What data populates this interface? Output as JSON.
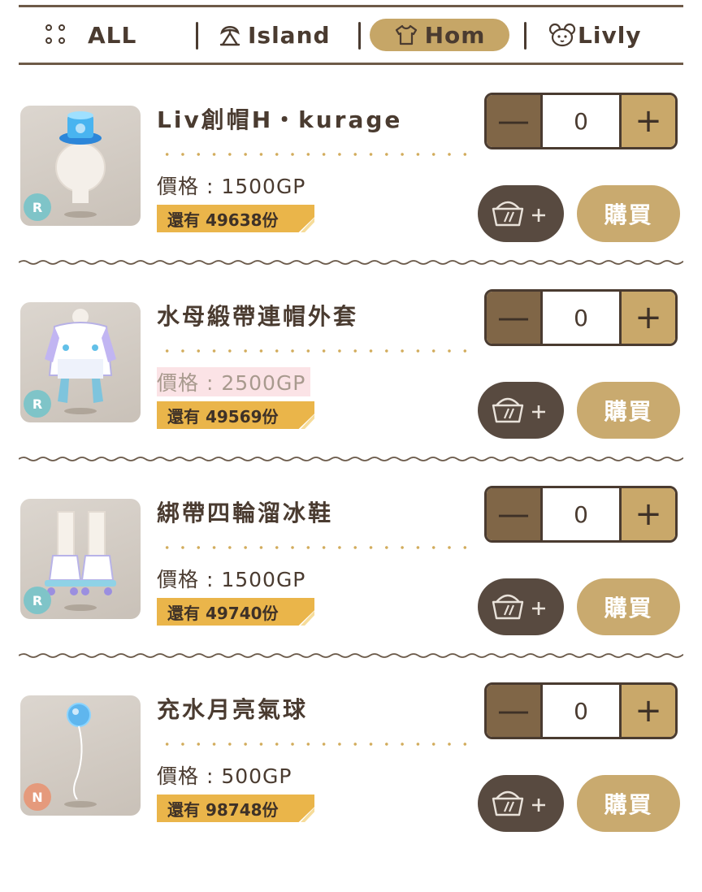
{
  "tabs": {
    "all": "ALL",
    "island": "Island",
    "hom": "Hom",
    "livly": "Livly",
    "active": "Hom"
  },
  "colors": {
    "accent": "#c6a667",
    "dark": "#4a3b30",
    "stock_banner": "#eab54a",
    "buy_button": "#c9aa6f",
    "cart_button": "#584a40"
  },
  "items": [
    {
      "name": "Liv創帽H・kurage",
      "price": "價格 : 1500GP",
      "stock": "還有 49638份",
      "rarity": "R",
      "qty": "0",
      "buy": "購買"
    },
    {
      "name": "水母緞帶連帽外套",
      "price": "價格 : 2500GP",
      "stock": "還有 49569份",
      "rarity": "R",
      "qty": "0",
      "buy": "購買"
    },
    {
      "name": "綁帶四輪溜冰鞋",
      "price": "價格 : 1500GP",
      "stock": "還有 49740份",
      "rarity": "R",
      "qty": "0",
      "buy": "購買"
    },
    {
      "name": "充水月亮氣球",
      "price": "價格 : 500GP",
      "stock": "還有 98748份",
      "rarity": "N",
      "qty": "0",
      "buy": "購買"
    }
  ],
  "icons": {
    "all": "grid-dots-icon",
    "island": "palm-tree-icon",
    "hom": "shirt-icon",
    "livly": "livly-face-icon",
    "cart": "basket-add-icon"
  }
}
